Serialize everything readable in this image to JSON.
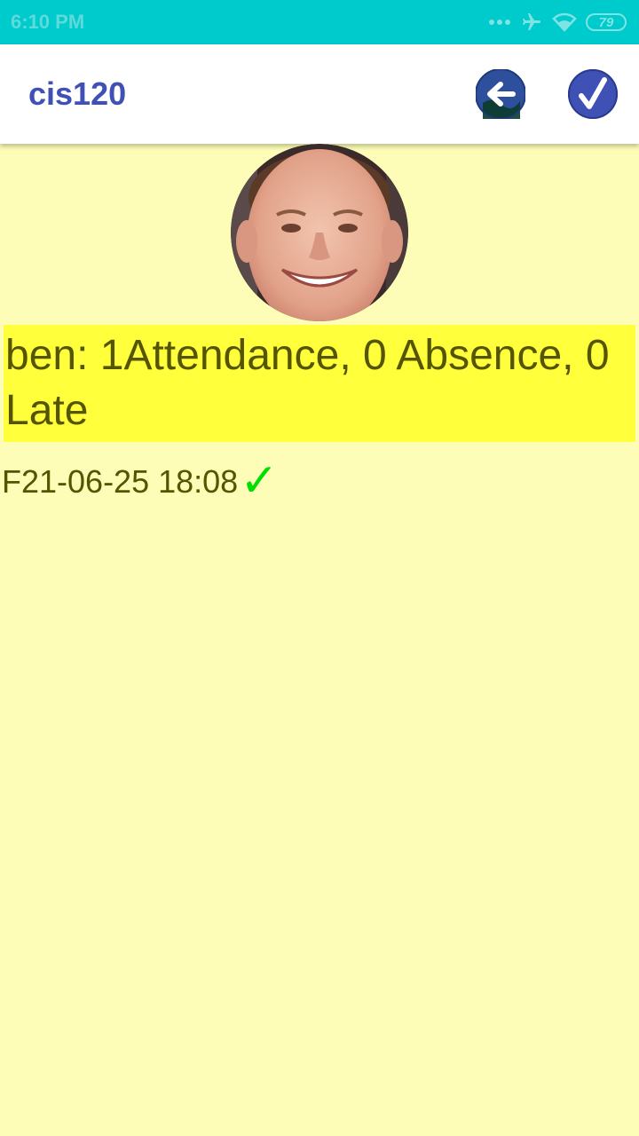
{
  "status_bar": {
    "time": "6:10 PM",
    "battery": "79"
  },
  "app_bar": {
    "title": "cis120",
    "back_icon": "back-arrow-icon",
    "confirm_icon": "checkmark-icon"
  },
  "student": {
    "summary": "ben: 1Attendance, 0 Absence, 0 Late"
  },
  "records": [
    {
      "date": "F21-06-25 18:08",
      "status_icon": "✓",
      "status_color": "#00e000"
    }
  ],
  "colors": {
    "status_bar": "#00cbcc",
    "accent": "#3f51b5",
    "background": "#fdfdb8",
    "summary_highlight": "#ffff3c",
    "text": "#555500"
  }
}
